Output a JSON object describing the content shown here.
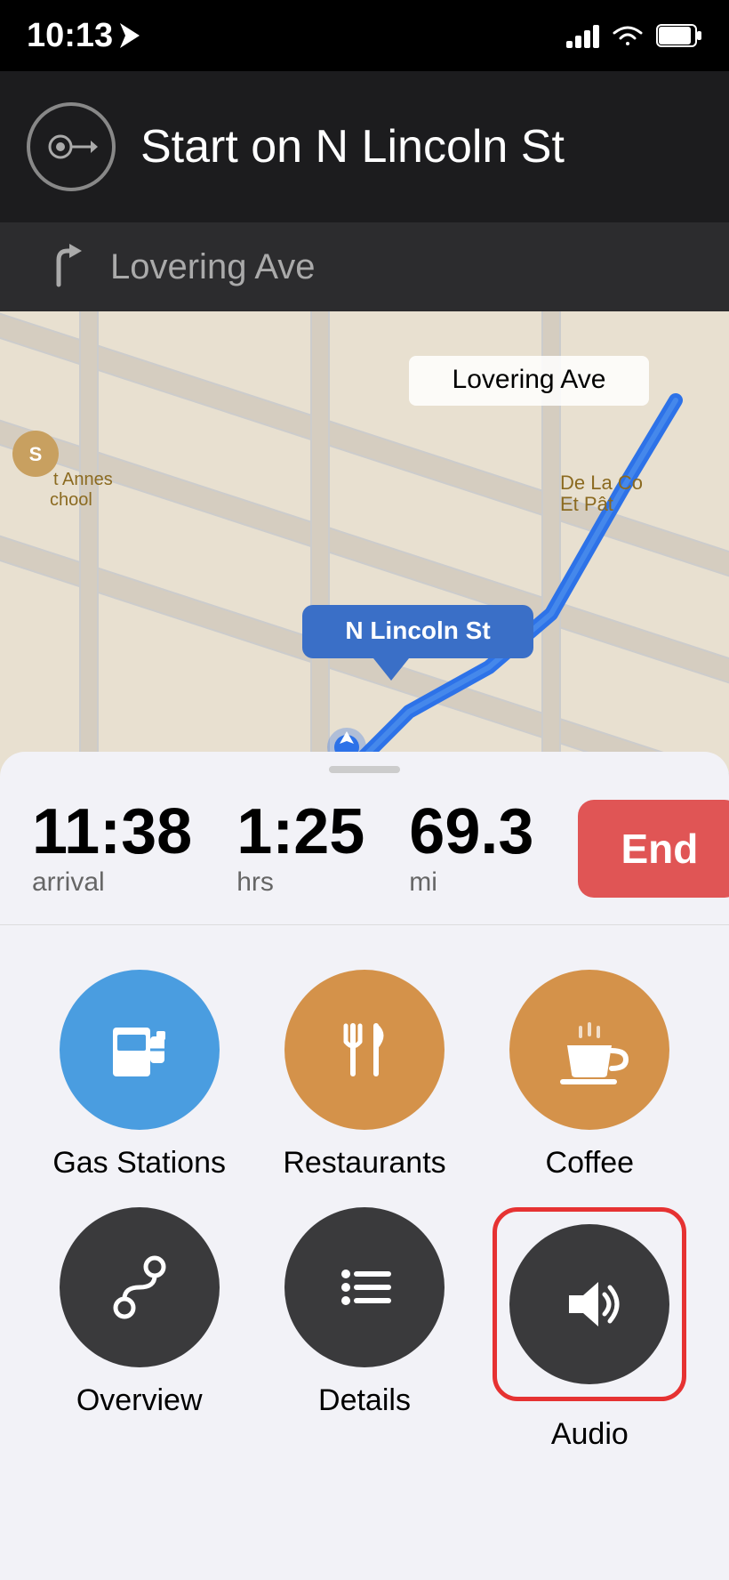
{
  "status": {
    "time": "10:13",
    "location_active": true
  },
  "navigation": {
    "primary_instruction": "Start on N Lincoln St",
    "secondary_instruction": "Lovering Ave",
    "map_labels": {
      "lovering_ave": "Lovering Ave",
      "n_lincoln_st": "N Lincoln St",
      "school": "St Annes School",
      "restaurant": "De La Co Et Pât"
    }
  },
  "eta": {
    "arrival_time": "11:38",
    "arrival_label": "arrival",
    "duration": "1:25",
    "duration_label": "hrs",
    "distance": "69.3",
    "distance_label": "mi",
    "end_button_label": "End"
  },
  "categories": [
    {
      "id": "gas-stations",
      "label": "Gas Stations",
      "color": "blue",
      "icon": "gas-pump"
    },
    {
      "id": "restaurants",
      "label": "Restaurants",
      "color": "orange",
      "icon": "fork-knife"
    },
    {
      "id": "coffee",
      "label": "Coffee",
      "color": "orange",
      "icon": "coffee-cup"
    },
    {
      "id": "overview",
      "label": "Overview",
      "color": "dark",
      "icon": "route-curve"
    },
    {
      "id": "details",
      "label": "Details",
      "color": "dark",
      "icon": "list"
    },
    {
      "id": "audio",
      "label": "Audio",
      "color": "dark",
      "icon": "speaker",
      "selected": true
    }
  ]
}
